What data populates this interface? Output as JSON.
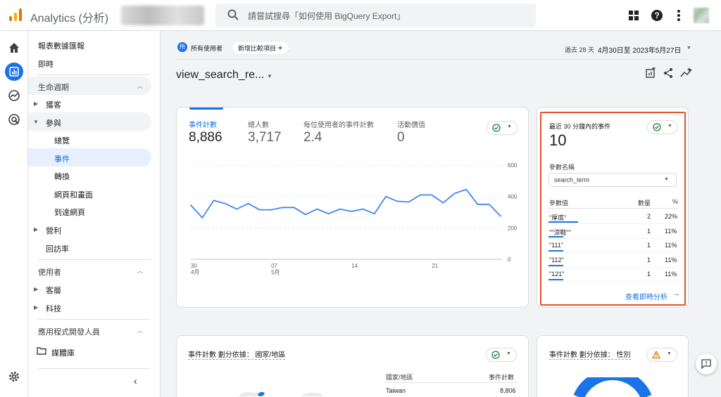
{
  "app": {
    "title": "Analytics (分析)"
  },
  "search": {
    "placeholder": "請嘗試搜尋「如何使用 BigQuery Export」"
  },
  "nav": {
    "reports_snapshot": "報表數據匯報",
    "realtime": "即時",
    "lifecycle": "生命週期",
    "acquisition": "獲客",
    "engagement": "參與",
    "overview": "總覽",
    "events": "事件",
    "conversions": "轉換",
    "pages_screens": "網頁和畫面",
    "landing_page": "到達網頁",
    "monetization": "營利",
    "retention": "回訪率",
    "user": "使用者",
    "demographics": "客層",
    "tech": "科技",
    "app_developer": "應用程式開發人員",
    "library": "媒體庫"
  },
  "filters": {
    "segment_badge": "所",
    "segment": "所有使用者",
    "add_comparison": "新增比較項目",
    "date_label": "過去 28 天",
    "date_range": "4月30日至 2023年5月27日"
  },
  "page": {
    "title": "view_search_re..."
  },
  "metrics": [
    {
      "label": "事件計數",
      "value": "8,886"
    },
    {
      "label": "總人數",
      "value": "3,717"
    },
    {
      "label": "每位使用者的事件計數",
      "value": "2.4"
    },
    {
      "label": "活動價值",
      "value": "0"
    }
  ],
  "chart_data": {
    "type": "line",
    "x_tick_labels": [
      "30\n4月",
      "07\n5月",
      "14",
      "21"
    ],
    "y_ticks": [
      0,
      200,
      400,
      600
    ],
    "ylim": [
      0,
      600
    ],
    "values": [
      345,
      265,
      375,
      355,
      320,
      355,
      315,
      315,
      330,
      330,
      285,
      320,
      290,
      320,
      305,
      320,
      290,
      400,
      370,
      365,
      410,
      410,
      360,
      420,
      445,
      350,
      350,
      275
    ],
    "series": [
      {
        "name": "事件計數",
        "color": "#4285f4"
      }
    ]
  },
  "realtime_card": {
    "title": "最近 30 分鐘內的事件",
    "value": "10",
    "param_name_label": "參數名稱",
    "param_name_value": "search_term",
    "col_value": "參數值",
    "col_count": "數量",
    "col_pct": "%",
    "rows": [
      {
        "value": "\"厚底\"",
        "count": "2",
        "pct": "22%",
        "bar": 0.22
      },
      {
        "value": "\"\"涼鞋\"\"",
        "count": "1",
        "pct": "11%",
        "bar": 0.11
      },
      {
        "value": "\"111\"",
        "count": "1",
        "pct": "11%",
        "bar": 0.11
      },
      {
        "value": "\"112\"",
        "count": "1",
        "pct": "11%",
        "bar": 0.11
      },
      {
        "value": "\"121\"",
        "count": "1",
        "pct": "11%",
        "bar": 0.11
      }
    ],
    "view_link": "查看即時分析"
  },
  "country_card": {
    "title": "事件計數 劃分依據： 國家/地區",
    "col_country": "國家/地區",
    "col_count": "事件計數",
    "rows": [
      {
        "country": "Taiwan",
        "count": "8,806"
      }
    ]
  },
  "gender_card": {
    "title": "事件計數 劃分依據： 性別"
  },
  "colors": {
    "accent": "#1a73e8",
    "highlight_border": "#e8512d",
    "ok": "#188038",
    "warn": "#e37400"
  }
}
